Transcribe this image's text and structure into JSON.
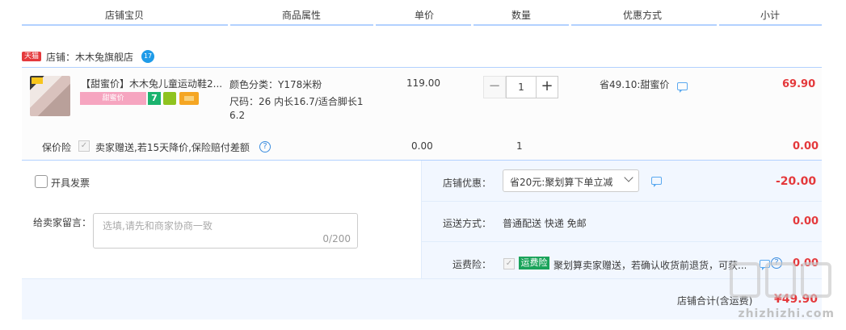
{
  "header": {
    "col_item": "店铺宝贝",
    "col_attr": "商品属性",
    "col_price": "单价",
    "col_qty": "数量",
    "col_discount": "优惠方式",
    "col_subtotal": "小计"
  },
  "shop": {
    "badge": "天猫",
    "name": "店铺：木木兔旗舰店",
    "wangwang": "17"
  },
  "item": {
    "title": "【甜蜜价】木木兔儿童运动鞋2...",
    "promo_tag": "甜蜜价",
    "tag_7": "7",
    "attr_color": "颜色分类：Y178米粉",
    "attr_size_1": "尺码：26 内长16.7/适合脚长1",
    "attr_size_2": "6.2",
    "price": "119.00",
    "quantity": "1",
    "discount": "省49.10:甜蜜价",
    "subtotal": "69.90"
  },
  "insurance": {
    "label": "保价险",
    "desc": "卖家赠送,若15天降价,保险赔付差额",
    "price": "0.00",
    "qty": "1",
    "subtotal": "0.00"
  },
  "invoice": {
    "label": "开具发票"
  },
  "message": {
    "label": "给卖家留言：",
    "placeholder": "选填,请先和商家协商一致",
    "counter": "0/200"
  },
  "shop_discount": {
    "label": "店铺优惠：",
    "selected": "省20元:聚划算下单立减",
    "amount": "-20.00"
  },
  "shipping": {
    "label": "运送方式：",
    "value": "普通配送 快递 免邮",
    "amount": "0.00"
  },
  "freight_insurance": {
    "label": "运费险：",
    "tag": "运费险",
    "desc": "聚划算卖家赠送，若确认收货前退货，可获...",
    "amount": "0.00"
  },
  "total": {
    "label": "店铺合计(含运费)",
    "amount": "¥49.90"
  },
  "watermark": {
    "glyph": "值",
    "text": "zhizhizhi.com"
  },
  "colors": {
    "accent_red": "#e4393c",
    "divider_blue": "#b2d1ff",
    "panel_bg": "#f2f7ff",
    "tmall_red": "#e4393c",
    "green_tag": "#1aa35a"
  }
}
